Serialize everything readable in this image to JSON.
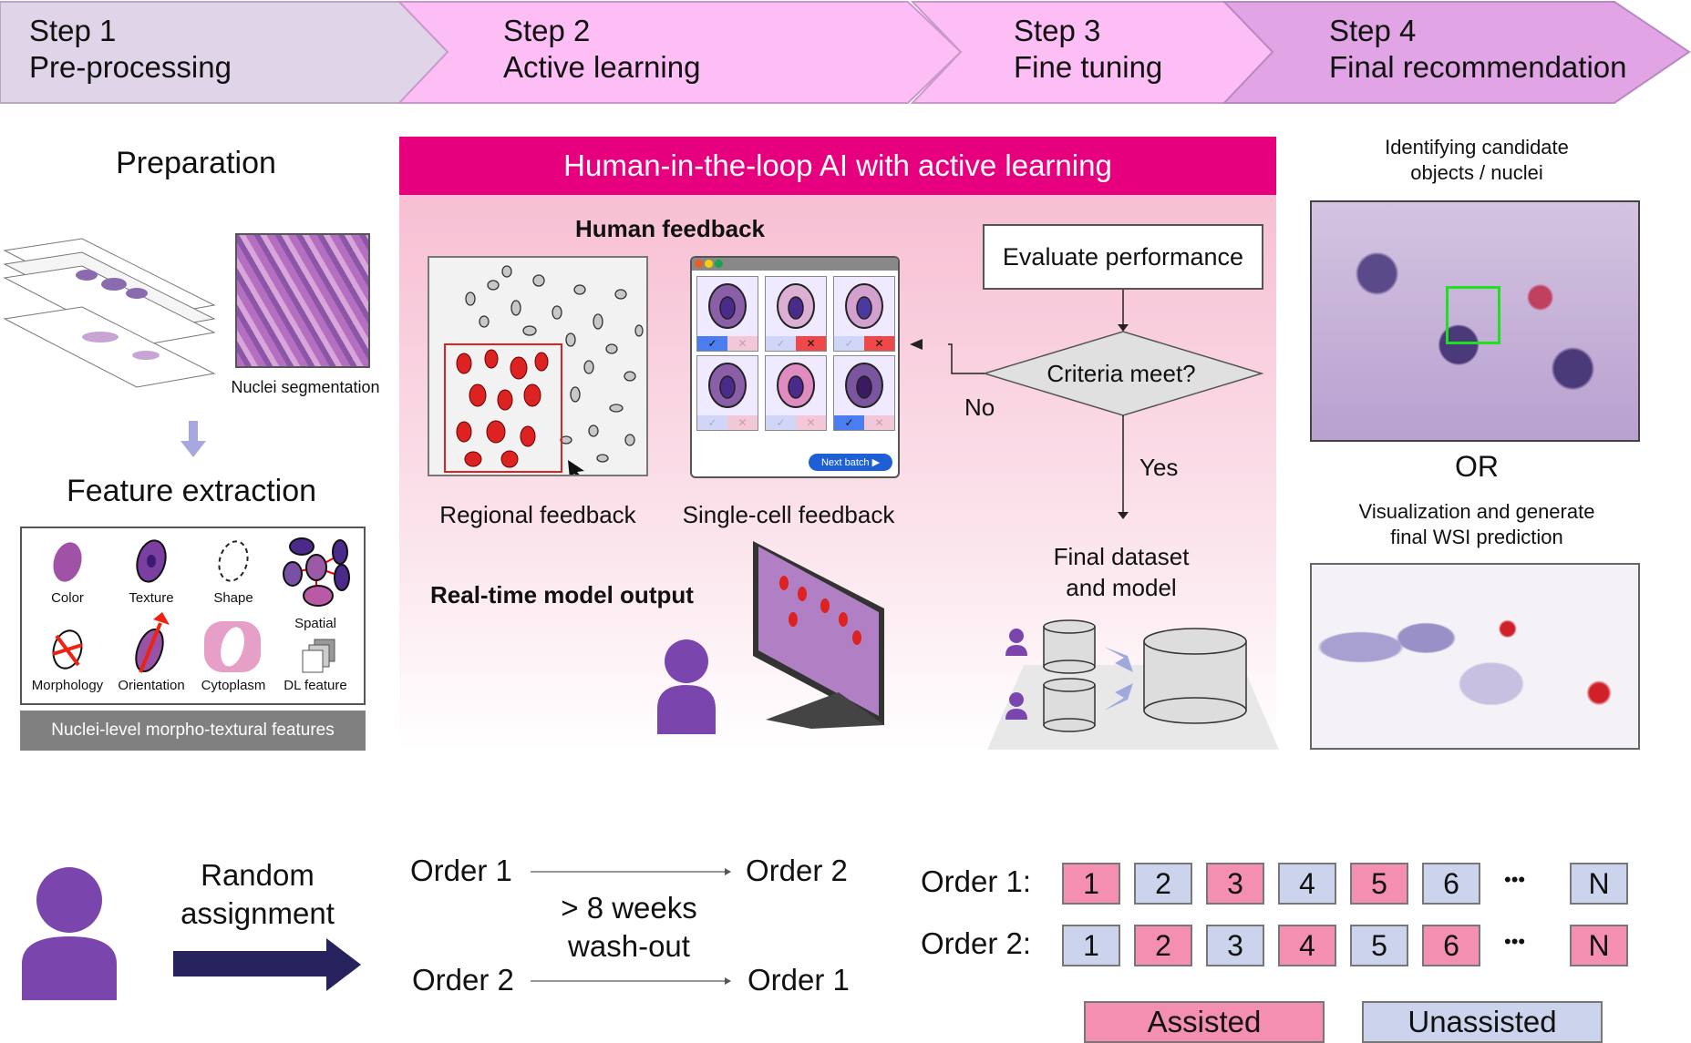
{
  "steps": [
    {
      "step": "Step 1",
      "name": "Pre-processing",
      "color": "#e0d4e8"
    },
    {
      "step": "Step 2",
      "name": "Active learning",
      "color": "#fdbdf5"
    },
    {
      "step": "Step 3",
      "name": "Fine tuning",
      "color": "#fdbdf5"
    },
    {
      "step": "Step 4",
      "name": "Final recommendation",
      "color": "#e1a4e4"
    }
  ],
  "preprocessing": {
    "preparation_title": "Preparation",
    "nuclei_segmentation_label": "Nuclei segmentation",
    "feature_extraction_title": "Feature extraction",
    "features": [
      "Color",
      "Texture",
      "Shape",
      "Spatial",
      "Morphology",
      "Orientation",
      "Cytoplasm",
      "DL feature"
    ],
    "features_caption": "Nuclei-level morpho-textural features"
  },
  "active_learning": {
    "banner": "Human-in-the-loop AI with active learning",
    "human_feedback_title": "Human feedback",
    "regional_feedback_label": "Regional feedback",
    "single_cell_feedback_label": "Single-cell feedback",
    "next_batch_label": "Next batch ▶",
    "cells": [
      {
        "accepted": true,
        "rejected": false
      },
      {
        "accepted": false,
        "rejected": true
      },
      {
        "accepted": false,
        "rejected": true
      },
      {
        "accepted": false,
        "rejected": false
      },
      {
        "accepted": false,
        "rejected": false
      },
      {
        "accepted": true,
        "rejected": false
      }
    ],
    "realtime_output_title": "Real-time model output",
    "evaluate_label": "Evaluate performance",
    "criteria_label": "Criteria meet?",
    "no_label": "No",
    "yes_label": "Yes",
    "final_dataset_label": "Final dataset\nand model",
    "banner_color": "#e6007e"
  },
  "recommendation": {
    "identify_label": "Identifying candidate\nobjects / nuclei",
    "or_label": "OR",
    "visualize_label": "Visualization and generate\nfinal WSI prediction"
  },
  "study_design": {
    "random_assignment_label": "Random\nassignment",
    "washout_label": "> 8 weeks\nwash-out",
    "crossover": [
      {
        "from": "Order 1",
        "to": "Order 2"
      },
      {
        "from": "Order 2",
        "to": "Order 1"
      }
    ],
    "sequences": [
      {
        "label": "Order 1:",
        "items": [
          {
            "v": "1",
            "type": "assisted"
          },
          {
            "v": "2",
            "type": "unassisted"
          },
          {
            "v": "3",
            "type": "assisted"
          },
          {
            "v": "4",
            "type": "unassisted"
          },
          {
            "v": "5",
            "type": "assisted"
          },
          {
            "v": "6",
            "type": "unassisted"
          },
          {
            "v": "N",
            "type": "unassisted"
          }
        ]
      },
      {
        "label": "Order 2:",
        "items": [
          {
            "v": "1",
            "type": "unassisted"
          },
          {
            "v": "2",
            "type": "assisted"
          },
          {
            "v": "3",
            "type": "unassisted"
          },
          {
            "v": "4",
            "type": "assisted"
          },
          {
            "v": "5",
            "type": "unassisted"
          },
          {
            "v": "6",
            "type": "assisted"
          },
          {
            "v": "N",
            "type": "assisted"
          }
        ]
      }
    ],
    "ellipsis": "•••",
    "legend": {
      "assisted": "Assisted",
      "unassisted": "Unassisted"
    },
    "assisted_color": "#f48fb1",
    "unassisted_color": "#ccd3ec"
  }
}
